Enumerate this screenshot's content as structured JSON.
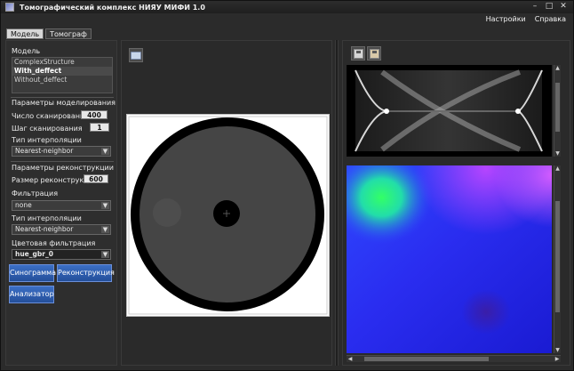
{
  "window": {
    "title": "Томографический комплекс НИЯУ МИФИ 1.0",
    "controls": [
      "–",
      "□",
      "✕"
    ]
  },
  "menu": {
    "items": [
      "Настройки",
      "Справка"
    ]
  },
  "tabs": [
    {
      "label": "Модель",
      "active": true
    },
    {
      "label": "Томограф",
      "active": false
    }
  ],
  "model": {
    "section_title": "Модель",
    "items": [
      {
        "label": "ComplexStructure",
        "selected": false
      },
      {
        "label": "With_deffect",
        "selected": true
      },
      {
        "label": "Without_deffect",
        "selected": false
      }
    ]
  },
  "modeling": {
    "section_title": "Параметры моделирования",
    "scan_count_label": "Число сканирований",
    "scan_count_value": "400",
    "scan_step_label": "Шаг сканирования",
    "scan_step_value": "1",
    "interp_label": "Тип интерполяции",
    "interp_value": "Nearest-neighbor"
  },
  "reconstruction": {
    "section_title": "Параметры реконструкции",
    "size_label": "Размер реконструкции",
    "size_value": "600",
    "filter_label": "Фильтрация",
    "filter_value": "none",
    "interp_label": "Тип интерполяции",
    "interp_value": "Nearest-neighbor",
    "color_filter_label": "Цветовая фильтрация",
    "color_filter_value": "hue_gbr_0"
  },
  "buttons": {
    "sinogram": "Синограмма",
    "reconstruction": "Реконструкция",
    "analyzer": "Анализатор"
  },
  "icons": {
    "app": "app-icon",
    "open": "folder-open-icon",
    "save": "save-icon",
    "save_as": "save-as-icon"
  },
  "colors": {
    "button_blue": "#2f5fb2",
    "panel_bg": "#2b2b2b",
    "object_black": "#000000",
    "object_fill": "#454545"
  }
}
